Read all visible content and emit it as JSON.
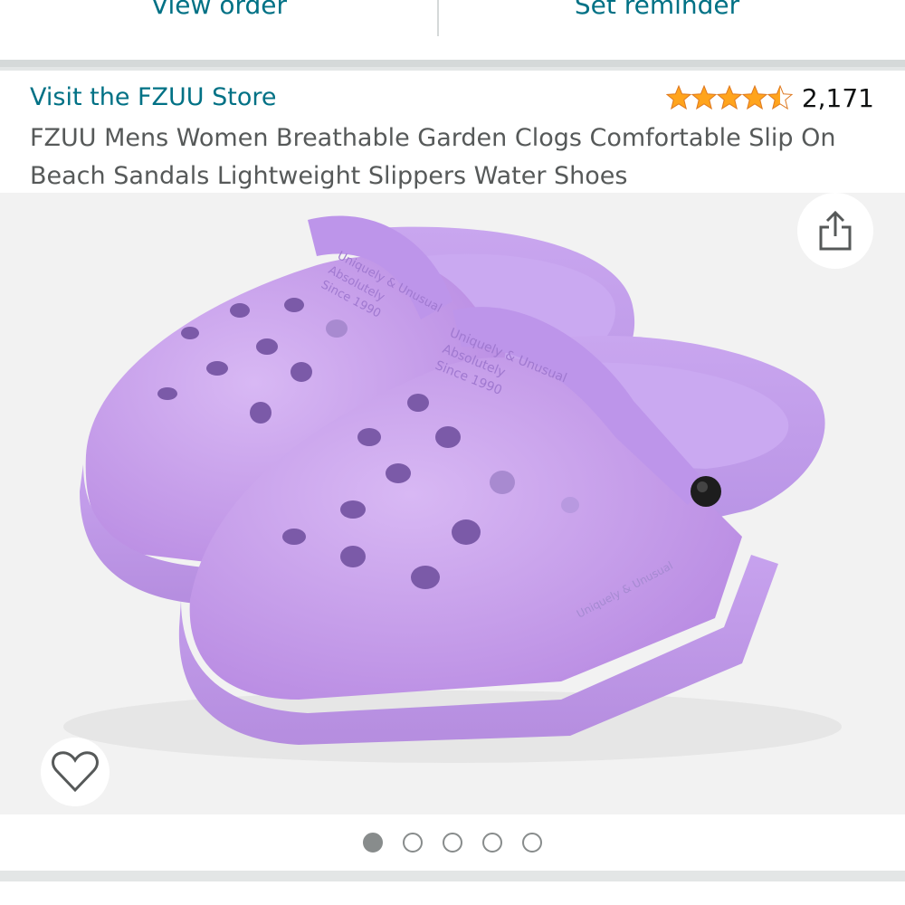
{
  "actions": {
    "view_order": "View order",
    "set_reminder": "Set reminder"
  },
  "product": {
    "store_link": "Visit the FZUU Store",
    "rating_stars": 4.5,
    "rating_count": "2,171",
    "title": "FZUU Mens Women Breathable Garden Clogs Comfortable Slip On Beach Sandals Lightweight Slippers Water Shoes"
  },
  "gallery": {
    "image_count": 5,
    "active_index": 0,
    "image_subject": "purple clogs",
    "image_text": [
      "Uniquely & Unusual",
      "Absolutely",
      "Since 1990"
    ],
    "share_icon": "share-icon",
    "wishlist_icon": "heart-icon"
  },
  "colors": {
    "link": "#007185",
    "star": "#ffa41c",
    "product_color": "#c8a0ea"
  }
}
